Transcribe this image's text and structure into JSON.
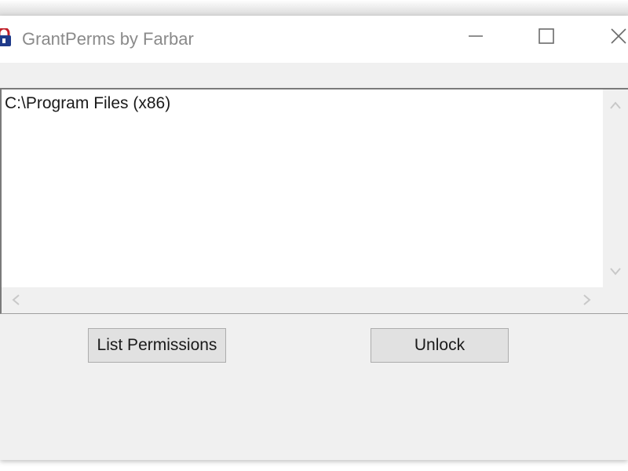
{
  "window": {
    "title": "GrantPerms by Farbar",
    "icons": {
      "app": "padlock-app-icon",
      "minimize": "minimize-icon",
      "maximize": "maximize-icon",
      "close": "close-icon"
    }
  },
  "listbox": {
    "items": [
      "C:\\Program Files (x86)"
    ],
    "scroll_icons": [
      "scroll-up-icon",
      "scroll-down-icon",
      "scroll-left-icon",
      "scroll-right-icon"
    ]
  },
  "buttons": {
    "list_permissions": "List Permissions",
    "unlock": "Unlock"
  },
  "colors": {
    "window_bg": "#f0f0f0",
    "titlebar_bg": "#ffffff",
    "title_text": "#8a8a8a",
    "button_bg": "#e1e1e1",
    "icon_blue": "#1f3a8a",
    "icon_red": "#c0202a"
  }
}
